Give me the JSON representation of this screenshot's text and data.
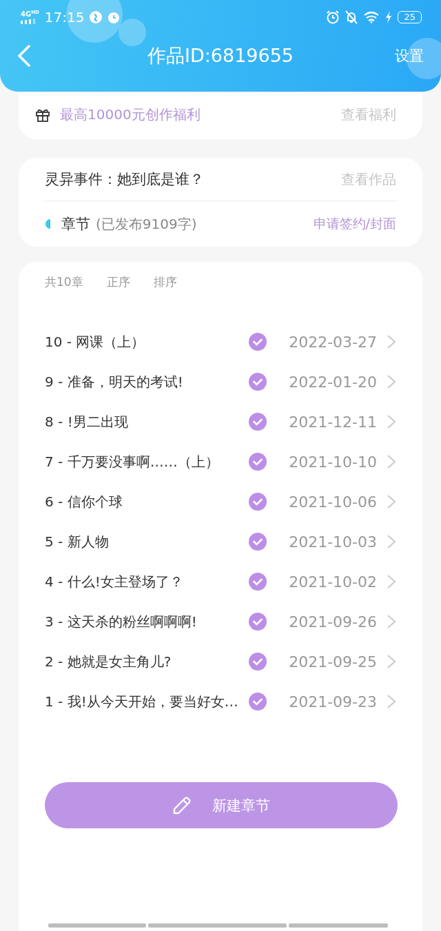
{
  "status_bar": {
    "network": "4G",
    "network_badge": "HD",
    "time": "17:15",
    "battery": "25"
  },
  "header": {
    "title": "作品ID:6819655",
    "action": "设置"
  },
  "welfare": {
    "text": "最高10000元创作福利",
    "link": "查看福利"
  },
  "work": {
    "title": "灵异事件：她到底是谁？",
    "link": "查看作品",
    "section": "章节",
    "published": "(已发布9109字)",
    "apply": "申请签约/封面"
  },
  "chapter_list": {
    "count": "共10章",
    "sort_options": [
      {
        "label": "正序",
        "selected": false
      },
      {
        "label": "排序",
        "selected": false
      }
    ],
    "chapters": [
      {
        "title": "10 - 网课（上）",
        "published": true,
        "date": "2022-03-27"
      },
      {
        "title": "9 - 准备，明天的考试!",
        "published": true,
        "date": "2022-01-20"
      },
      {
        "title": "8 - !男二出现",
        "published": true,
        "date": "2021-12-11"
      },
      {
        "title": "7 - 千万要没事啊……（上）",
        "published": true,
        "date": "2021-10-10"
      },
      {
        "title": "6 - 信你个球",
        "published": true,
        "date": "2021-10-06"
      },
      {
        "title": "5 - 新人物",
        "published": true,
        "date": "2021-10-03"
      },
      {
        "title": "4 - 什么!女主登场了？",
        "published": true,
        "date": "2021-10-02"
      },
      {
        "title": "3 - 这天杀的粉丝啊啊啊!",
        "published": true,
        "date": "2021-09-26"
      },
      {
        "title": "2 - 她就是女主角儿?",
        "published": true,
        "date": "2021-09-25"
      },
      {
        "title": "1 - 我!从今天开始，要当好女…",
        "published": true,
        "date": "2021-09-23"
      }
    ]
  },
  "new_chapter_button": "新建章节"
}
